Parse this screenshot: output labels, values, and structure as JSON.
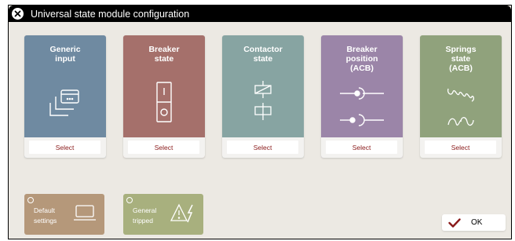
{
  "window": {
    "title": "Universal state module configuration"
  },
  "cards": [
    {
      "label": "Generic\ninput",
      "select_label": "Select",
      "color": "#6f8aa1",
      "icon": "generic-input-icon"
    },
    {
      "label": "Breaker\nstate",
      "select_label": "Select",
      "color": "#a5706b",
      "icon": "breaker-state-icon"
    },
    {
      "label": "Contactor\nstate",
      "select_label": "Select",
      "color": "#87a4a2",
      "icon": "contactor-state-icon"
    },
    {
      "label": "Breaker\nposition\n(ACB)",
      "select_label": "Select",
      "color": "#9b85a8",
      "icon": "breaker-position-icon"
    },
    {
      "label": "Springs\nstate\n(ACB)",
      "select_label": "Select",
      "color": "#90a27c",
      "icon": "springs-state-icon"
    }
  ],
  "tiles": [
    {
      "label": "Default\nsettings",
      "color": "#b5987a",
      "icon": "laptop-icon"
    },
    {
      "label": "General\ntripped",
      "color": "#a8b07e",
      "icon": "warning-lightning-icon"
    }
  ],
  "ok_button": {
    "label": "OK"
  },
  "colors": {
    "accent": "#8a1a1a",
    "titlebar": "#000000",
    "background": "#ece9e3"
  }
}
